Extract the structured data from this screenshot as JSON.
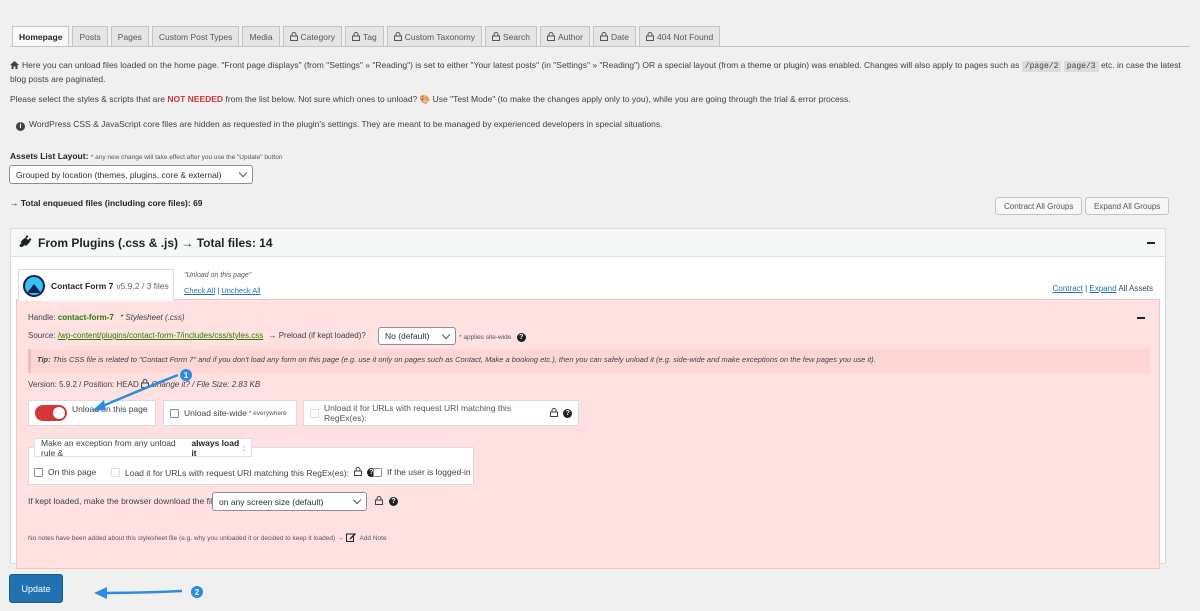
{
  "tabs": [
    {
      "label": "Homepage",
      "locked": false,
      "active": true
    },
    {
      "label": "Posts",
      "locked": false
    },
    {
      "label": "Pages",
      "locked": false
    },
    {
      "label": "Custom Post Types",
      "locked": false
    },
    {
      "label": "Media",
      "locked": false
    },
    {
      "label": "Category",
      "locked": true
    },
    {
      "label": "Tag",
      "locked": true
    },
    {
      "label": "Custom Taxonomy",
      "locked": true
    },
    {
      "label": "Search",
      "locked": true
    },
    {
      "label": "Author",
      "locked": true
    },
    {
      "label": "Date",
      "locked": true
    },
    {
      "label": "404 Not Found",
      "locked": true
    }
  ],
  "intro": {
    "line1a": "Here you can unload files loaded on the home page. \"Front page displays\" (from \"Settings\" » \"Reading\") is set to either \"Your latest posts\" (in \"Settings\" » \"Reading\") OR a special layout (from a theme or plugin) was enabled. Changes will also apply to pages such as",
    "code1": "/page/2",
    "code2": "page/3",
    "line1b": "etc. in case the latest blog posts are paginated.",
    "line2a": "Please select the styles & scripts that are",
    "line2_strong": "NOT NEEDED",
    "line2b": "from the list below. Not sure which ones to unload? 🎨 Use \"Test Mode\" (to make the changes apply only to you), while you are going through the trial & error process.",
    "line3": "WordPress CSS & JavaScript core files are hidden as requested in the plugin's settings. They are meant to be managed by experienced developers in special situations."
  },
  "layout": {
    "label": "Assets List Layout:",
    "note": "* any new change will take effect after you use the \"Update\" button",
    "selected": "Grouped by location (themes, plugins, core & external)"
  },
  "total_files": "→ Total enqueued files (including core files): 69",
  "buttons": {
    "contract_all": "Contract All Groups",
    "expand_all": "Expand All Groups",
    "update": "Update"
  },
  "panel": {
    "title": "From Plugins (.css & .js) → Total files: 14",
    "plugin_name": "Contact Form 7",
    "plugin_meta": "v5.9.2 / 3 files",
    "unload_on_page": "\"Unload on this page\"",
    "check_all": "Check All",
    "uncheck_all": "Uncheck All",
    "contract": "Contract",
    "expand": "Expand",
    "all_assets": "All Assets"
  },
  "asset": {
    "handle_label": "Handle:",
    "handle": "contact-form-7",
    "type": "* Stylesheet (.css)",
    "source_label": "Source:",
    "source": "/wp-content/plugins/contact-form-7/includes/css/styles.css",
    "preload_label": "→ Preload (if kept loaded)?",
    "preload_value": "No (default)",
    "preload_note": "* applies site-wide",
    "tip_label": "Tip:",
    "tip": "This CSS file is related to \"Contact Form 7\" and if you don't load any form on this page (e.g. use it only on pages such as Contact, Make a booking etc.), then you can safely unload it (e.g. side-wide and make exceptions on the few pages you use it).",
    "version_line": "Version: 5.9.2 / Position: HEAD",
    "change_it": "Change it?",
    "size": "/ File Size: 2.83 KB",
    "unload_page": "Unload on this page",
    "unload_site": "Unload site-wide",
    "everywhere": "* everywhere",
    "unload_regex": "Unload it for URLs with request URI matching this RegEx(es):",
    "exception_title_a": "Make an exception from any unload rule &",
    "exception_title_b": "always load it",
    "exception_title_c": ":",
    "on_this_page": "On this page",
    "load_regex": "Load it for URLs with request URI matching this RegEx(es):",
    "logged_in": "If the user is logged-in",
    "download_label": "If kept loaded, make the browser download the file",
    "download_value": "on any screen size (default)",
    "notes": "No notes have been added about this stylesheet file (e.g. why you unloaded it or decided to keep it loaded) →",
    "add_note": "Add Note"
  },
  "badges": {
    "one": "1",
    "two": "2"
  },
  "colors": {
    "accent": "#2271b1",
    "toggle_on": "#d63638",
    "pink_bg": "#ffe1e1",
    "arrow": "#2d8ce0"
  }
}
